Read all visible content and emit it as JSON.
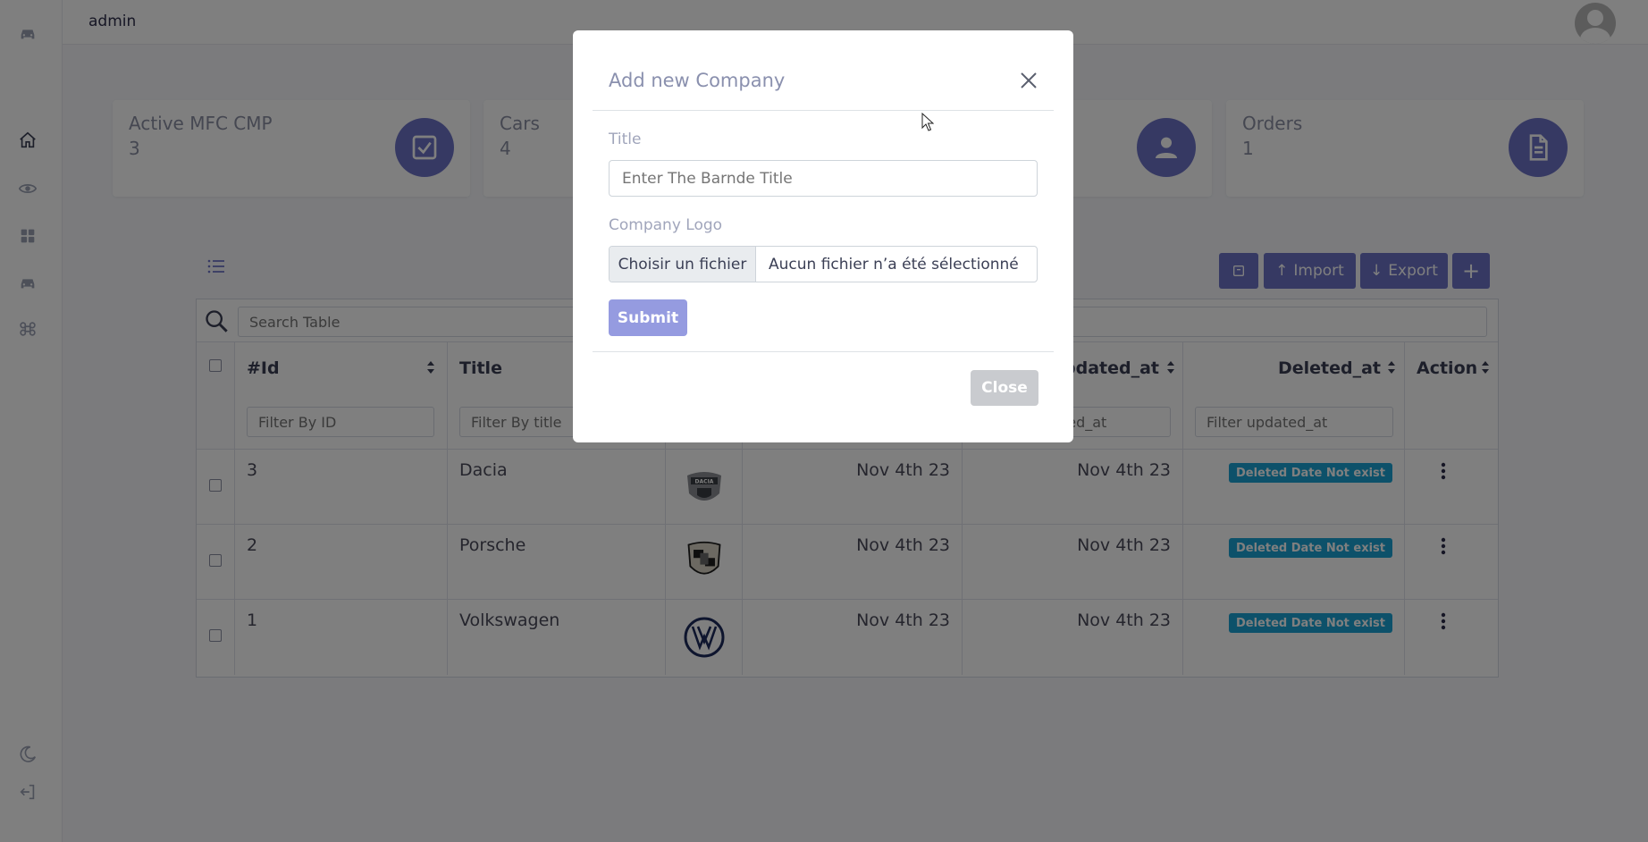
{
  "topbar": {
    "user_name": "admin"
  },
  "stats": [
    {
      "label": "Active MFC CMP",
      "value": "3",
      "icon": "checkbox-icon"
    },
    {
      "label": "Cars",
      "value": "4",
      "icon": "car-icon"
    },
    {
      "label": "",
      "value": "",
      "icon": "user-icon"
    },
    {
      "label": "Orders",
      "value": "1",
      "icon": "document-icon"
    }
  ],
  "toolbar": {
    "import_label": "Import",
    "export_label": "Export",
    "add_label": "+"
  },
  "table": {
    "search_placeholder": "Search Table",
    "columns": [
      "#Id",
      "Title",
      "",
      "",
      "Updated_at",
      "Deleted_at",
      "Action"
    ],
    "filters": {
      "id": "Filter By ID",
      "title": "Filter By title",
      "updated": "Filter updated_at",
      "deleted": "Filter updated_at"
    },
    "rows": [
      {
        "id": "3",
        "title": "Dacia",
        "logo": "dacia-logo",
        "created": "Nov 4th 23",
        "updated": "Nov 4th 23",
        "deleted": "Deleted Date Not exist"
      },
      {
        "id": "2",
        "title": "Porsche",
        "logo": "porsche-logo",
        "created": "Nov 4th 23",
        "updated": "Nov 4th 23",
        "deleted": "Deleted Date Not exist"
      },
      {
        "id": "1",
        "title": "Volkswagen",
        "logo": "volkswagen-logo",
        "created": "Nov 4th 23",
        "updated": "Nov 4th 23",
        "deleted": "Deleted Date Not exist"
      }
    ]
  },
  "modal": {
    "title": "Add new Company",
    "title_label": "Title",
    "title_placeholder": "Enter The Barnde Title",
    "logo_label": "Company Logo",
    "choose_file": "Choisir un fichier",
    "no_file": "Aucun fichier n’a été sélectionné",
    "submit": "Submit",
    "close": "Close"
  },
  "colors": {
    "accent": "#6c72c7",
    "badge": "#1aa3d4",
    "submit": "#959be0"
  }
}
